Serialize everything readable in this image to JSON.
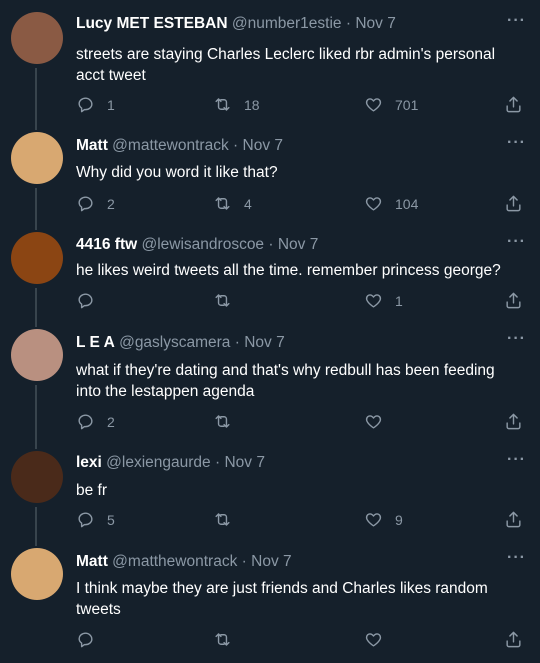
{
  "tweets": [
    {
      "name": "Lucy MET ESTEBAN",
      "handle": "@number1estie",
      "date": "Nov 7",
      "text": "streets are staying Charles Leclerc liked rbr admin's personal acct tweet",
      "replies": "1",
      "retweets": "18",
      "likes": "701",
      "avatar_color": "#8a5a44"
    },
    {
      "name": "Matt",
      "handle": "@mattewontrack",
      "date": "Nov 7",
      "text": "Why did you word it like that?",
      "replies": "2",
      "retweets": "4",
      "likes": "104",
      "avatar_color": "#d8a871"
    },
    {
      "name": "4416 ftw",
      "handle": "@lewisandroscoe",
      "date": "Nov 7",
      "text": "he likes weird tweets all the time. remember princess george?",
      "replies": "",
      "retweets": "",
      "likes": "1",
      "avatar_color": "#8b4513"
    },
    {
      "name": "L E A",
      "handle": "@gaslyscamera",
      "date": "Nov 7",
      "text": "what if they're dating and that's why redbull has been feeding into the lestappen agenda",
      "replies": "2",
      "retweets": "",
      "likes": "",
      "avatar_color": "#b99080"
    },
    {
      "name": "lexi",
      "handle": "@lexiengaurde",
      "date": "Nov 7",
      "text": "be fr",
      "replies": "5",
      "retweets": "",
      "likes": "9",
      "avatar_color": "#4a2a1a"
    },
    {
      "name": "Matt",
      "handle": "@matthewontrack",
      "date": "Nov 7",
      "text": "I think maybe they are just friends and Charles likes random tweets",
      "replies": "",
      "retweets": "",
      "likes": "",
      "avatar_color": "#d8a871"
    }
  ],
  "separator": "·",
  "more_label": "···",
  "icons": {
    "reply": "reply-icon",
    "retweet": "retweet-icon",
    "like": "heart-icon",
    "share": "share-icon",
    "more": "more-icon"
  }
}
